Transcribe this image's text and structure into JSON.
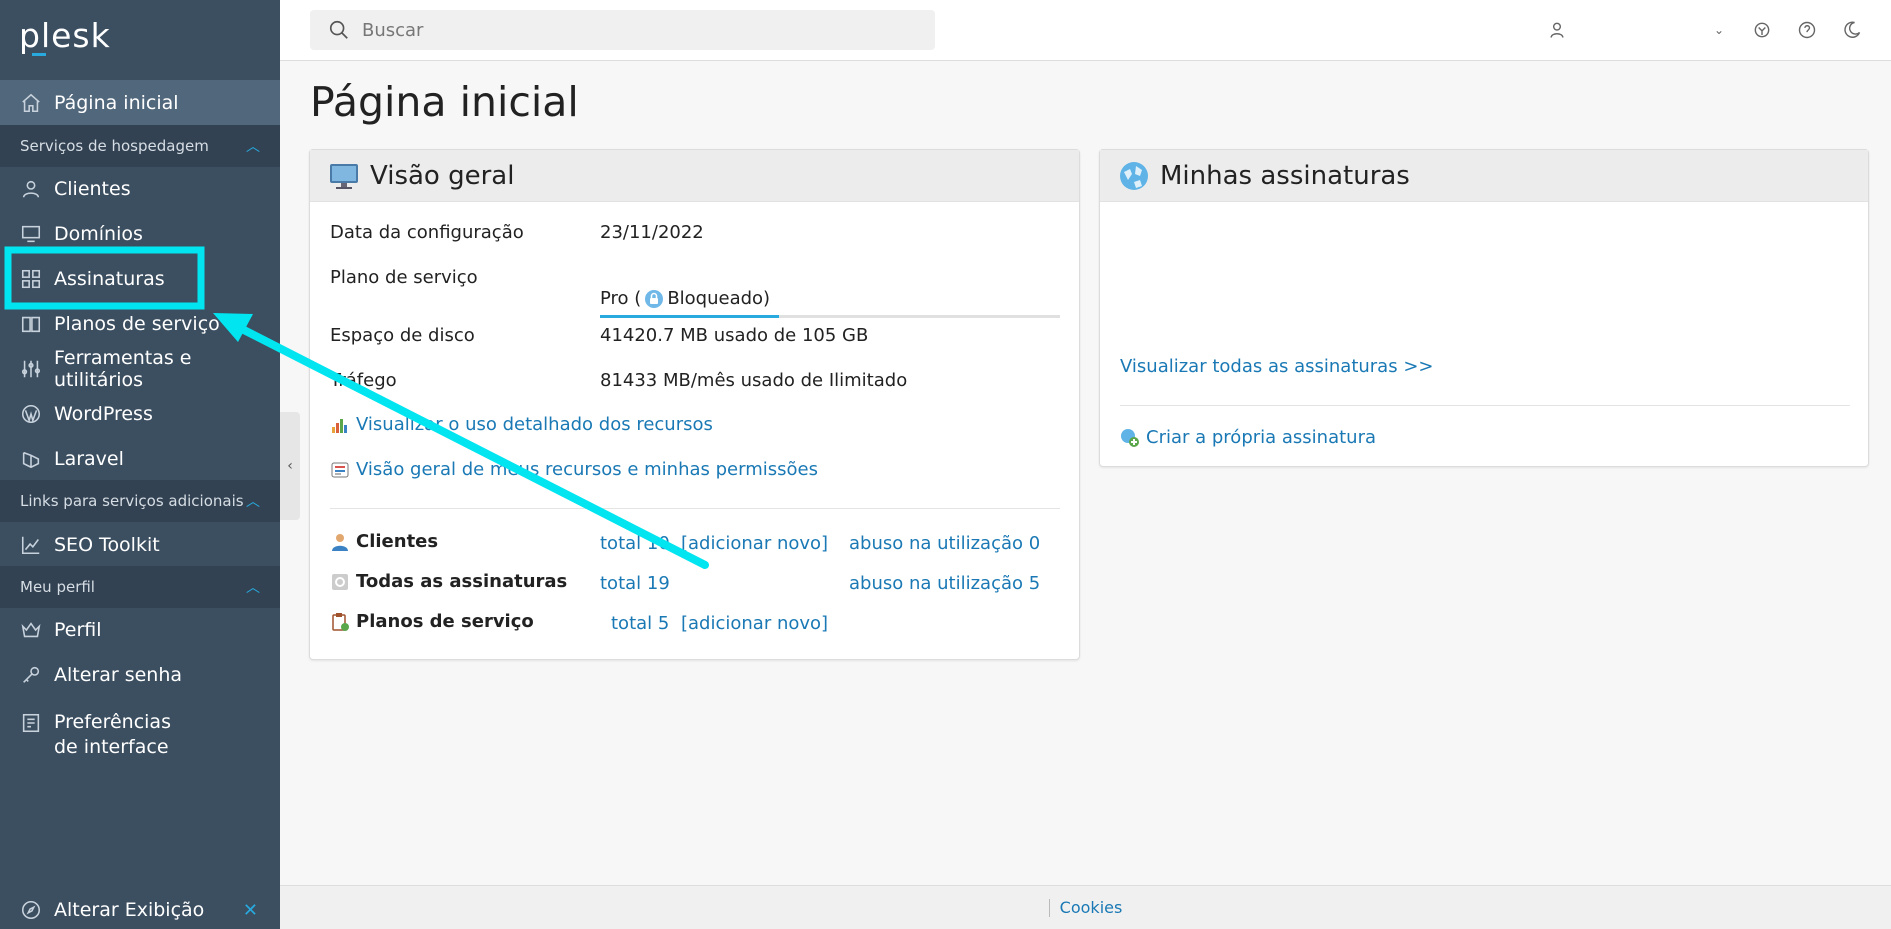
{
  "brand": {
    "logo": "plesk"
  },
  "sidebar": {
    "home": "Página inicial",
    "section_hosting": "Serviços de hospedagem",
    "items_hosting": [
      {
        "label": "Clientes",
        "icon": "user-icon"
      },
      {
        "label": "Domínios",
        "icon": "monitor-icon"
      },
      {
        "label": "Assinaturas",
        "icon": "grid-icon"
      },
      {
        "label": "Planos de serviço",
        "icon": "book-icon"
      },
      {
        "label": "Ferramentas e utilitários",
        "icon": "sliders-icon"
      },
      {
        "label": "WordPress",
        "icon": "wordpress-icon"
      },
      {
        "label": "Laravel",
        "icon": "laravel-icon"
      }
    ],
    "section_links": "Links para serviços adicionais",
    "items_links": [
      {
        "label": "SEO Toolkit",
        "icon": "chart-icon"
      }
    ],
    "section_profile": "Meu perfil",
    "items_profile": [
      {
        "label": "Perfil",
        "icon": "crown-icon"
      },
      {
        "label": "Alterar senha",
        "icon": "key-icon"
      },
      {
        "label": "Preferências de interface",
        "icon": "settings-panel-icon"
      }
    ],
    "bottom": "Alterar Exibição"
  },
  "header": {
    "search_placeholder": "Buscar"
  },
  "page": {
    "title": "Página inicial"
  },
  "overview": {
    "title": "Visão geral",
    "rows": {
      "config_label": "Data da configuração",
      "config_value": "23/11/2022",
      "plan_label": "Plano de serviço",
      "plan_value_prefix": "Pro (",
      "plan_value_suffix": "Bloqueado)",
      "disk_label": "Espaço de disco",
      "disk_value": "41420.7 MB usado de 105 GB",
      "disk_usage_fraction": 0.39,
      "traffic_label": "Tráfego",
      "traffic_value": "81433 MB/mês usado de Ilimitado"
    },
    "links": {
      "detailed_usage": "Visualizar o uso detalhado dos recursos",
      "resources_permissions": "Visão geral de meus recursos e minhas permissões"
    },
    "stats": {
      "clients_label": "Clientes",
      "clients_total": "total 10",
      "clients_add": "[adicionar novo]",
      "clients_abuse": "abuso na utilização 0",
      "subs_label": "Todas as assinaturas",
      "subs_total": "total 19",
      "subs_abuse": "abuso na utilização 5",
      "plans_label": "Planos de serviço",
      "plans_total": "total 5",
      "plans_add": "[adicionar novo]"
    }
  },
  "subscriptions": {
    "title": "Minhas assinaturas",
    "view_all": "Visualizar todas as assinaturas >>",
    "create_own": "Criar a própria assinatura"
  },
  "footer": {
    "cookies": "Cookies"
  },
  "colors": {
    "sidebar": "#3c4f61",
    "accent": "#28aade",
    "link": "#1a79b5",
    "highlight": "#00e5f0"
  }
}
